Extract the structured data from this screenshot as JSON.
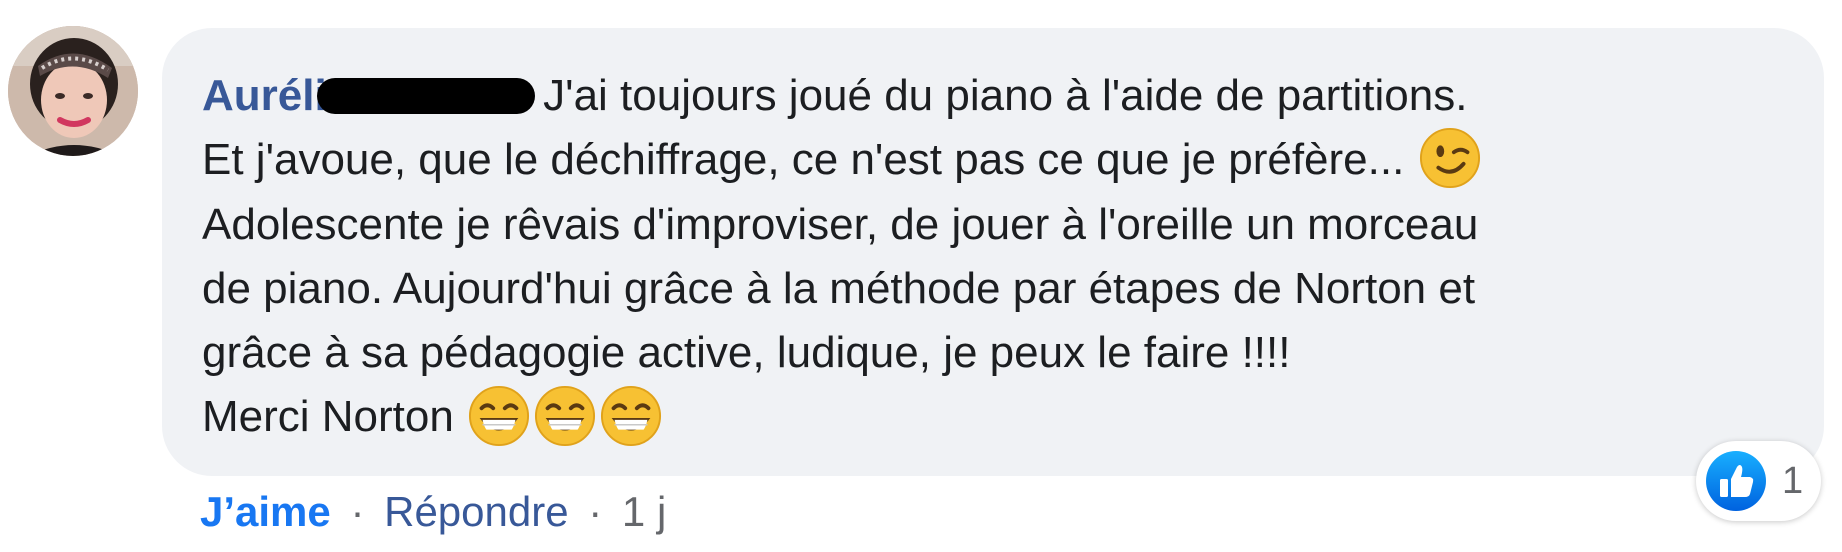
{
  "comment": {
    "author_name": "Aurélie",
    "text_lines": [
      "J'ai toujours joué du piano à l'aide de partitions.",
      "Et j'avoue, que le déchiffrage, ce n'est pas ce que je préfère...",
      "Adolescente je rêvais d'improviser, de jouer à l'oreille un morceau",
      "de piano. Aujourd'hui grâce à la méthode par étapes de Norton et",
      "grâce à sa pédagogie active, ludique, je peux le faire !!!!",
      "Merci Norton"
    ],
    "emojis": {
      "line2": "winking-face-emoji",
      "line6": [
        "grinning-face-emoji",
        "grinning-face-emoji",
        "grinning-face-emoji"
      ]
    }
  },
  "actions": {
    "like_label": "J’aime",
    "separator": "·",
    "reply_label": "Répondre",
    "timestamp": "1 j"
  },
  "reactions": {
    "icon": "thumbs-up-icon",
    "count": "1"
  },
  "colors": {
    "author": "#385898",
    "like": "#1877f2",
    "bubble_bg": "#f0f2f5",
    "meta": "#65676b"
  }
}
